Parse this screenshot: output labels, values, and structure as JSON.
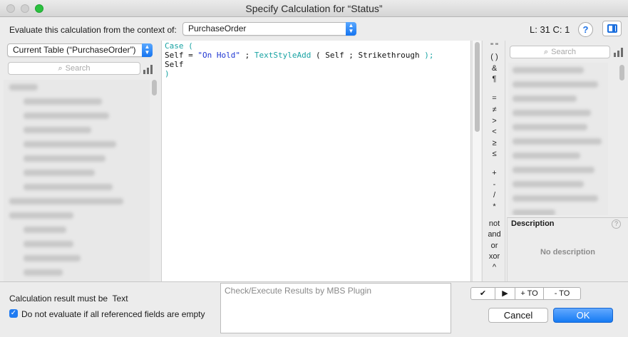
{
  "window": {
    "title": "Specify Calculation for “Status”"
  },
  "context": {
    "label": "Evaluate this calculation from the context of:",
    "selected": "PurchaseOrder"
  },
  "cursor_position": "L: 31 C: 1",
  "help_icon": "question-mark-icon",
  "fields_panel": {
    "table_selected": "Current Table (“PurchaseOrder”)",
    "search_placeholder": "Search"
  },
  "functions_panel": {
    "search_placeholder": "Search"
  },
  "editor": {
    "lines": [
      {
        "parts": [
          {
            "t": "Case (",
            "c": "kw"
          }
        ]
      },
      {
        "parts": [
          {
            "t": "Self = "
          },
          {
            "t": "\"On Hold\"",
            "c": "str"
          },
          {
            "t": " ; "
          },
          {
            "t": "TextStyleAdd",
            "c": "kw"
          },
          {
            "t": " ( Self ; Strikethrough "
          },
          {
            "t": ");",
            "c": "kw"
          }
        ]
      },
      {
        "parts": [
          {
            "t": "Self"
          }
        ]
      },
      {
        "parts": [
          {
            "t": ")",
            "c": "kw"
          }
        ]
      }
    ]
  },
  "operators": [
    "\" \"",
    "( )",
    "&",
    "¶",
    "=",
    "≠",
    ">",
    "<",
    "≥",
    "≤",
    "+",
    "-",
    "/",
    "*",
    "not",
    "and",
    "or",
    "xor",
    "^"
  ],
  "description": {
    "title": "Description",
    "body": "No description"
  },
  "result_type": {
    "label": "Calculation result must be",
    "value": "Text"
  },
  "evaluate_checkbox": {
    "label": "Do not evaluate if all referenced fields are empty",
    "checked": true
  },
  "mbs_results": {
    "placeholder": "Check/Execute Results by MBS Plugin"
  },
  "segment_buttons": [
    "✔",
    "▶",
    "+ TO",
    "- TO"
  ],
  "buttons": {
    "cancel": "Cancel",
    "ok": "OK"
  },
  "colors": {
    "accent": "#1f7bf2",
    "keyword": "#19a3a3",
    "string": "#1f36d2"
  }
}
